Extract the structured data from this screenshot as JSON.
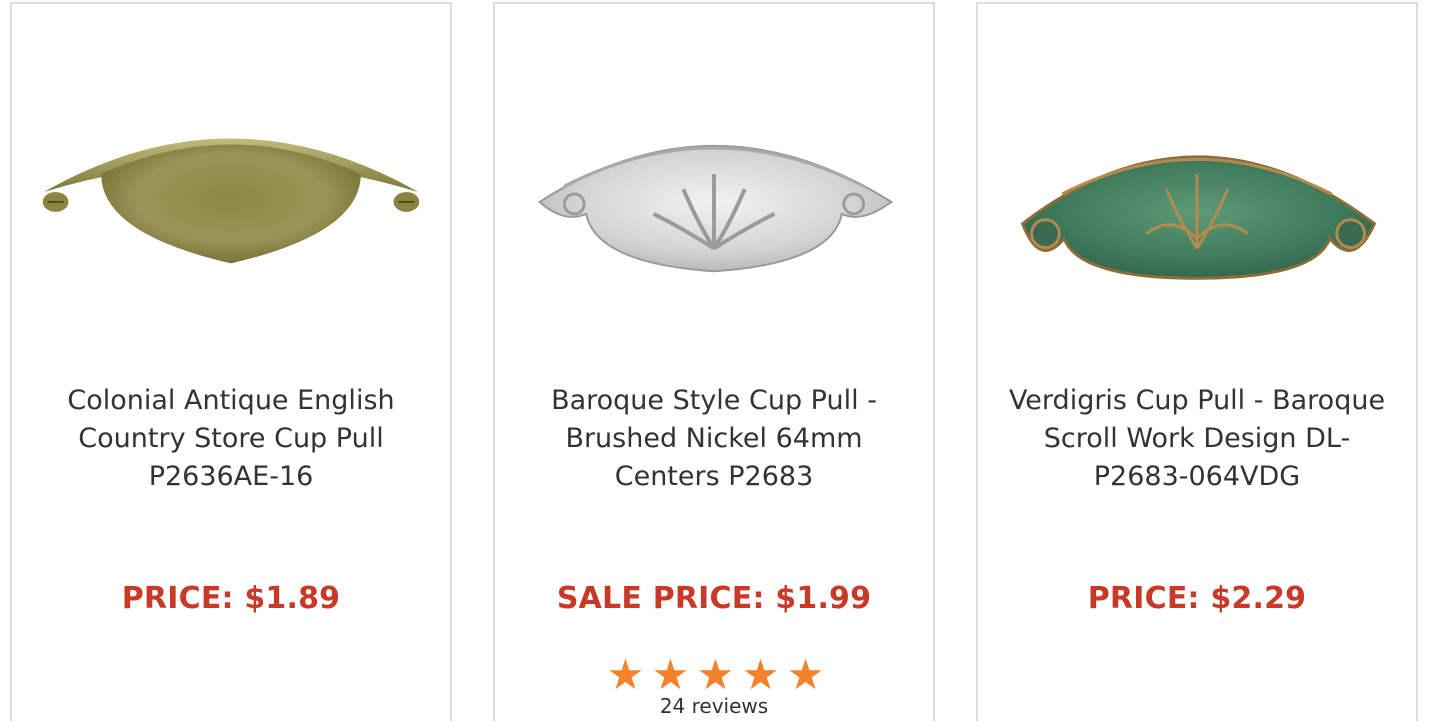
{
  "colors": {
    "price": "#c83a27",
    "star": "#f4822a",
    "border": "#dddddd",
    "text": "#333333"
  },
  "products": [
    {
      "title": "Colonial Antique English Country Store Cup Pull P2636AE-16",
      "price": "PRICE: $1.89",
      "image_icon": "antique-brass-cup-pull-image"
    },
    {
      "title": "Baroque Style Cup Pull - Brushed Nickel 64mm Centers P2683",
      "price": "SALE PRICE: $1.99",
      "image_icon": "brushed-nickel-cup-pull-image",
      "rating": {
        "stars": 5,
        "star_glyph": "★",
        "reviews": "24 reviews"
      }
    },
    {
      "title": "Verdigris Cup Pull - Baroque Scroll Work Design DL-P2683-064VDG",
      "price": "PRICE: $2.29",
      "image_icon": "verdigris-cup-pull-image"
    }
  ]
}
